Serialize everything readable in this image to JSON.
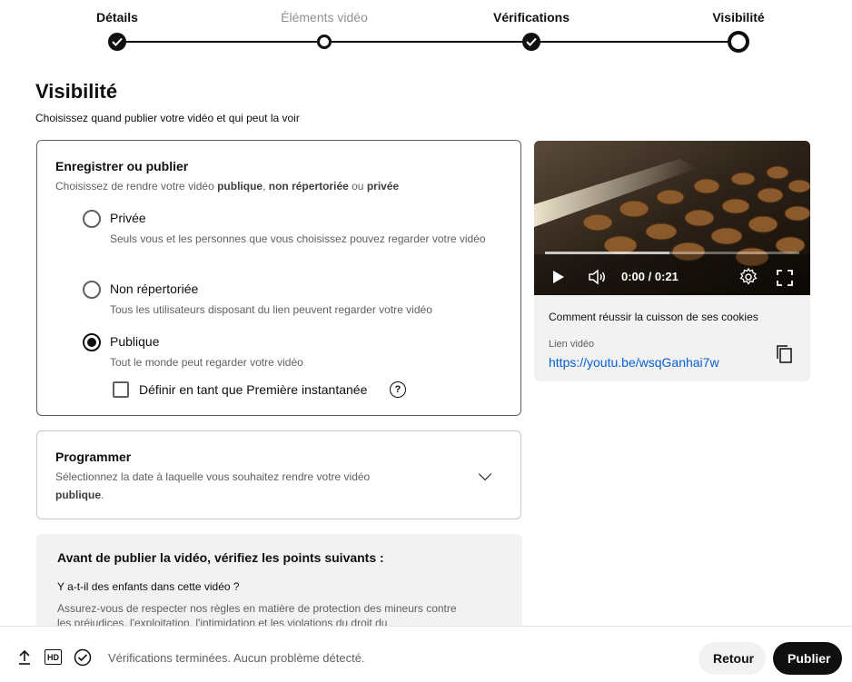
{
  "stepper": {
    "steps": [
      {
        "label": "Détails",
        "state": "done"
      },
      {
        "label": "Éléments vidéo",
        "state": "inactive"
      },
      {
        "label": "Vérifications",
        "state": "done"
      },
      {
        "label": "Visibilité",
        "state": "current"
      }
    ]
  },
  "page": {
    "title": "Visibilité",
    "subtitle": "Choisissez quand publier votre vidéo et qui peut la voir"
  },
  "save_publish": {
    "title": "Enregistrer ou publier",
    "desc_prefix": "Choisissez de rendre votre vidéo ",
    "desc_public": "publique",
    "desc_sep": ", ",
    "desc_unlisted": "non répertoriée",
    "desc_or": " ou ",
    "desc_private": "privée",
    "options": [
      {
        "label": "Privée",
        "help": "Seuls vous et les personnes que vous choisissez pouvez regarder votre vidéo",
        "selected": false
      },
      {
        "label": "Non répertoriée",
        "help": "Tous les utilisateurs disposant du lien peuvent regarder votre vidéo",
        "selected": false
      },
      {
        "label": "Publique",
        "help": "Tout le monde peut regarder votre vidéo",
        "selected": true
      }
    ],
    "premiere_checkbox_label": "Définir en tant que Première instantanée",
    "premiere_checked": false,
    "help_glyph": "?"
  },
  "schedule": {
    "title": "Programmer",
    "desc": "Sélectionnez la date à laquelle vous souhaitez rendre votre vidéo",
    "desc_bold": "publique",
    "desc_end": "."
  },
  "checklist": {
    "title": "Avant de publier la vidéo, vérifiez les points suivants :",
    "question": "Y a-t-il des enfants dans cette vidéo ?",
    "text": "Assurez-vous de respecter nos règles en matière de protection des mineurs contre les préjudices, l'exploitation, l'intimidation et les violations du droit du"
  },
  "video": {
    "time": "0:00 / 0:21",
    "progress_fraction": 0.49,
    "title": "Comment réussir la cuisson de ses cookies",
    "link_label": "Lien vidéo",
    "link": "https://youtu.be/wsqGanhai7w"
  },
  "footer": {
    "status": "Vérifications terminées. Aucun problème détecté.",
    "hd_label": "HD",
    "back_label": "Retour",
    "publish_label": "Publier"
  }
}
